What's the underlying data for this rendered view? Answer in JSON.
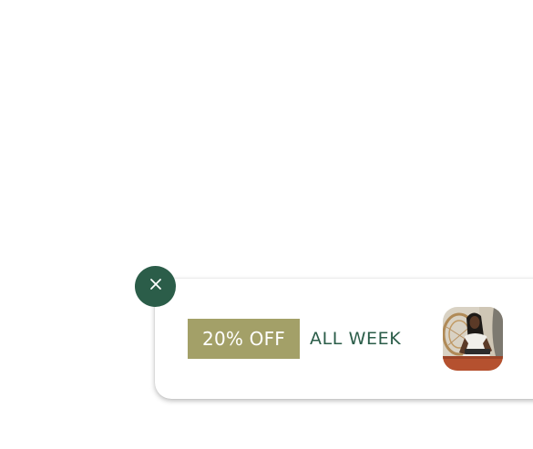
{
  "popup": {
    "badge_text": "20% OFF",
    "message_text": "ALL WEEK",
    "thumbnail_icon": "woman-with-laptop-photo",
    "close_icon": "close-icon"
  },
  "colors": {
    "brand_green": "#2b5d49",
    "badge_olive": "#a3a068",
    "background": "#ffffff"
  }
}
